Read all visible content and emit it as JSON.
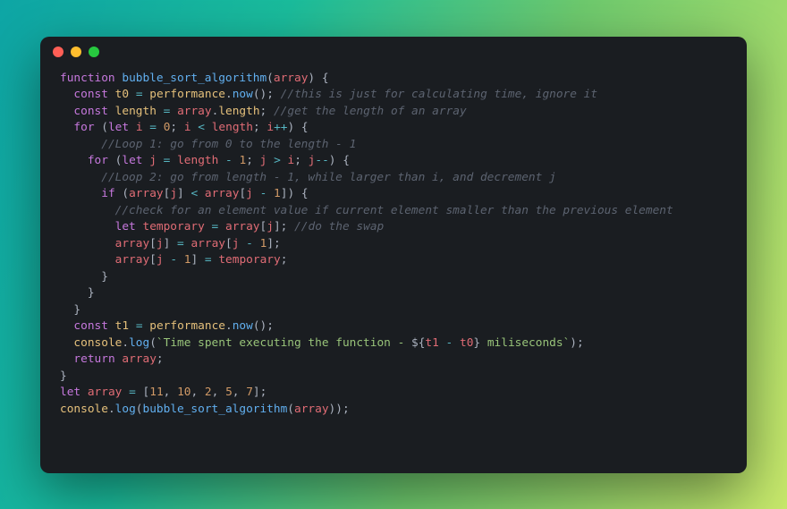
{
  "traffic_lights": {
    "red": "#ff5f56",
    "yellow": "#ffbd2e",
    "green": "#27c93f"
  },
  "code_lines": [
    [
      [
        "kw",
        "function"
      ],
      [
        "p",
        " "
      ],
      [
        "fn",
        "bubble_sort_algorithm"
      ],
      [
        "p",
        "("
      ],
      [
        "id",
        "array"
      ],
      [
        "p",
        ") {"
      ]
    ],
    [
      [
        "p",
        "  "
      ],
      [
        "kw",
        "const"
      ],
      [
        "p",
        " "
      ],
      [
        "var",
        "t0"
      ],
      [
        "p",
        " "
      ],
      [
        "op",
        "="
      ],
      [
        "p",
        " "
      ],
      [
        "var",
        "performance"
      ],
      [
        "p",
        "."
      ],
      [
        "fn",
        "now"
      ],
      [
        "p",
        "(); "
      ],
      [
        "cm",
        "//this is just for calculating time, ignore it"
      ]
    ],
    [
      [
        "p",
        "  "
      ],
      [
        "kw",
        "const"
      ],
      [
        "p",
        " "
      ],
      [
        "var",
        "length"
      ],
      [
        "p",
        " "
      ],
      [
        "op",
        "="
      ],
      [
        "p",
        " "
      ],
      [
        "id",
        "array"
      ],
      [
        "p",
        "."
      ],
      [
        "var",
        "length"
      ],
      [
        "p",
        "; "
      ],
      [
        "cm",
        "//get the length of an array"
      ]
    ],
    [
      [
        "p",
        "  "
      ],
      [
        "kw",
        "for"
      ],
      [
        "p",
        " ("
      ],
      [
        "kw",
        "let"
      ],
      [
        "p",
        " "
      ],
      [
        "id",
        "i"
      ],
      [
        "p",
        " "
      ],
      [
        "op",
        "="
      ],
      [
        "p",
        " "
      ],
      [
        "num",
        "0"
      ],
      [
        "p",
        "; "
      ],
      [
        "id",
        "i"
      ],
      [
        "p",
        " "
      ],
      [
        "op",
        "<"
      ],
      [
        "p",
        " "
      ],
      [
        "id",
        "length"
      ],
      [
        "p",
        "; "
      ],
      [
        "id",
        "i"
      ],
      [
        "op",
        "++"
      ],
      [
        "p",
        ") {"
      ]
    ],
    [
      [
        "p",
        "      "
      ],
      [
        "cm",
        "//Loop 1: go from 0 to the length - 1"
      ]
    ],
    [
      [
        "p",
        "    "
      ],
      [
        "kw",
        "for"
      ],
      [
        "p",
        " ("
      ],
      [
        "kw",
        "let"
      ],
      [
        "p",
        " "
      ],
      [
        "id",
        "j"
      ],
      [
        "p",
        " "
      ],
      [
        "op",
        "="
      ],
      [
        "p",
        " "
      ],
      [
        "id",
        "length"
      ],
      [
        "p",
        " "
      ],
      [
        "op",
        "-"
      ],
      [
        "p",
        " "
      ],
      [
        "num",
        "1"
      ],
      [
        "p",
        "; "
      ],
      [
        "id",
        "j"
      ],
      [
        "p",
        " "
      ],
      [
        "op",
        ">"
      ],
      [
        "p",
        " "
      ],
      [
        "id",
        "i"
      ],
      [
        "p",
        "; "
      ],
      [
        "id",
        "j"
      ],
      [
        "op",
        "--"
      ],
      [
        "p",
        ") {"
      ]
    ],
    [
      [
        "p",
        "      "
      ],
      [
        "cm",
        "//Loop 2: go from length - 1, while larger than i, and decrement j"
      ]
    ],
    [
      [
        "p",
        "      "
      ],
      [
        "kw",
        "if"
      ],
      [
        "p",
        " ("
      ],
      [
        "id",
        "array"
      ],
      [
        "p",
        "["
      ],
      [
        "id",
        "j"
      ],
      [
        "p",
        "] "
      ],
      [
        "op",
        "<"
      ],
      [
        "p",
        " "
      ],
      [
        "id",
        "array"
      ],
      [
        "p",
        "["
      ],
      [
        "id",
        "j"
      ],
      [
        "p",
        " "
      ],
      [
        "op",
        "-"
      ],
      [
        "p",
        " "
      ],
      [
        "num",
        "1"
      ],
      [
        "p",
        "]) {"
      ]
    ],
    [
      [
        "p",
        "        "
      ],
      [
        "cm",
        "//check for an element value if current element smaller than the previous element"
      ]
    ],
    [
      [
        "p",
        "        "
      ],
      [
        "kw",
        "let"
      ],
      [
        "p",
        " "
      ],
      [
        "id",
        "temporary"
      ],
      [
        "p",
        " "
      ],
      [
        "op",
        "="
      ],
      [
        "p",
        " "
      ],
      [
        "id",
        "array"
      ],
      [
        "p",
        "["
      ],
      [
        "id",
        "j"
      ],
      [
        "p",
        "]; "
      ],
      [
        "cm",
        "//do the swap"
      ]
    ],
    [
      [
        "p",
        "        "
      ],
      [
        "id",
        "array"
      ],
      [
        "p",
        "["
      ],
      [
        "id",
        "j"
      ],
      [
        "p",
        "] "
      ],
      [
        "op",
        "="
      ],
      [
        "p",
        " "
      ],
      [
        "id",
        "array"
      ],
      [
        "p",
        "["
      ],
      [
        "id",
        "j"
      ],
      [
        "p",
        " "
      ],
      [
        "op",
        "-"
      ],
      [
        "p",
        " "
      ],
      [
        "num",
        "1"
      ],
      [
        "p",
        "];"
      ]
    ],
    [
      [
        "p",
        "        "
      ],
      [
        "id",
        "array"
      ],
      [
        "p",
        "["
      ],
      [
        "id",
        "j"
      ],
      [
        "p",
        " "
      ],
      [
        "op",
        "-"
      ],
      [
        "p",
        " "
      ],
      [
        "num",
        "1"
      ],
      [
        "p",
        "] "
      ],
      [
        "op",
        "="
      ],
      [
        "p",
        " "
      ],
      [
        "id",
        "temporary"
      ],
      [
        "p",
        ";"
      ]
    ],
    [
      [
        "p",
        "      }"
      ]
    ],
    [
      [
        "p",
        "    }"
      ]
    ],
    [
      [
        "p",
        "  }"
      ]
    ],
    [
      [
        "p",
        "  "
      ],
      [
        "kw",
        "const"
      ],
      [
        "p",
        " "
      ],
      [
        "var",
        "t1"
      ],
      [
        "p",
        " "
      ],
      [
        "op",
        "="
      ],
      [
        "p",
        " "
      ],
      [
        "var",
        "performance"
      ],
      [
        "p",
        "."
      ],
      [
        "fn",
        "now"
      ],
      [
        "p",
        "();"
      ]
    ],
    [
      [
        "p",
        "  "
      ],
      [
        "var",
        "console"
      ],
      [
        "p",
        "."
      ],
      [
        "fn",
        "log"
      ],
      [
        "p",
        "("
      ],
      [
        "str",
        "`Time spent executing the function - "
      ],
      [
        "p",
        "${"
      ],
      [
        "tmpl",
        "t1"
      ],
      [
        "p",
        " "
      ],
      [
        "op",
        "-"
      ],
      [
        "p",
        " "
      ],
      [
        "tmpl",
        "t0"
      ],
      [
        "p",
        "}"
      ],
      [
        "str",
        " miliseconds`"
      ],
      [
        "p",
        ");"
      ]
    ],
    [
      [
        "p",
        "  "
      ],
      [
        "kw",
        "return"
      ],
      [
        "p",
        " "
      ],
      [
        "id",
        "array"
      ],
      [
        "p",
        ";"
      ]
    ],
    [
      [
        "p",
        "}"
      ]
    ],
    [
      [
        "p",
        ""
      ]
    ],
    [
      [
        "kw",
        "let"
      ],
      [
        "p",
        " "
      ],
      [
        "id",
        "array"
      ],
      [
        "p",
        " "
      ],
      [
        "op",
        "="
      ],
      [
        "p",
        " ["
      ],
      [
        "num",
        "11"
      ],
      [
        "p",
        ", "
      ],
      [
        "num",
        "10"
      ],
      [
        "p",
        ", "
      ],
      [
        "num",
        "2"
      ],
      [
        "p",
        ", "
      ],
      [
        "num",
        "5"
      ],
      [
        "p",
        ", "
      ],
      [
        "num",
        "7"
      ],
      [
        "p",
        "];"
      ]
    ],
    [
      [
        "var",
        "console"
      ],
      [
        "p",
        "."
      ],
      [
        "fn",
        "log"
      ],
      [
        "p",
        "("
      ],
      [
        "fn",
        "bubble_sort_algorithm"
      ],
      [
        "p",
        "("
      ],
      [
        "id",
        "array"
      ],
      [
        "p",
        "));"
      ]
    ]
  ]
}
